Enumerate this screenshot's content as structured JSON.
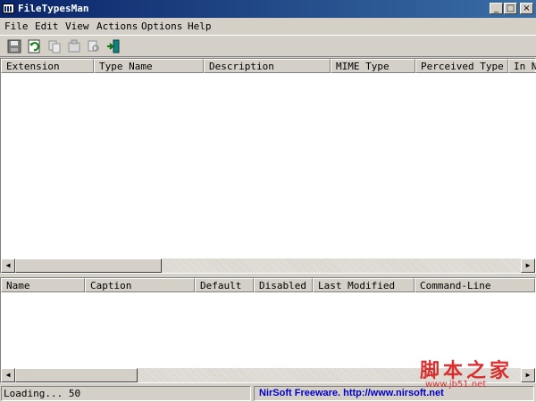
{
  "window": {
    "title": "FileTypesMan",
    "controls": {
      "minimize": "_",
      "maximize": "□",
      "close": "×"
    }
  },
  "menu": [
    "File",
    "Edit",
    "View",
    "Actions",
    "Options",
    "Help"
  ],
  "toolbar": {
    "icons": [
      "save-icon",
      "refresh-icon",
      "copy-icon",
      "properties-icon",
      "find-icon",
      "exit-icon"
    ]
  },
  "upper_list": {
    "columns": [
      "Extension",
      "Type Name",
      "Description",
      "MIME Type",
      "Perceived Type",
      "In N"
    ],
    "rows": []
  },
  "lower_list": {
    "columns": [
      "Name",
      "Caption",
      "Default",
      "Disabled",
      "Last Modified",
      "Command-Line"
    ],
    "rows": []
  },
  "scrollbar": {
    "left_arrow": "◀",
    "right_arrow": "▶"
  },
  "status": {
    "loading": "Loading... 50",
    "link": "NirSoft Freeware.  http://www.nirsoft.net"
  },
  "watermark": {
    "text": "脚本之家",
    "url": "www.jb51.net"
  },
  "colors": {
    "titlebar": "#0a246a",
    "link": "#0000c8",
    "watermark": "#d82020"
  }
}
